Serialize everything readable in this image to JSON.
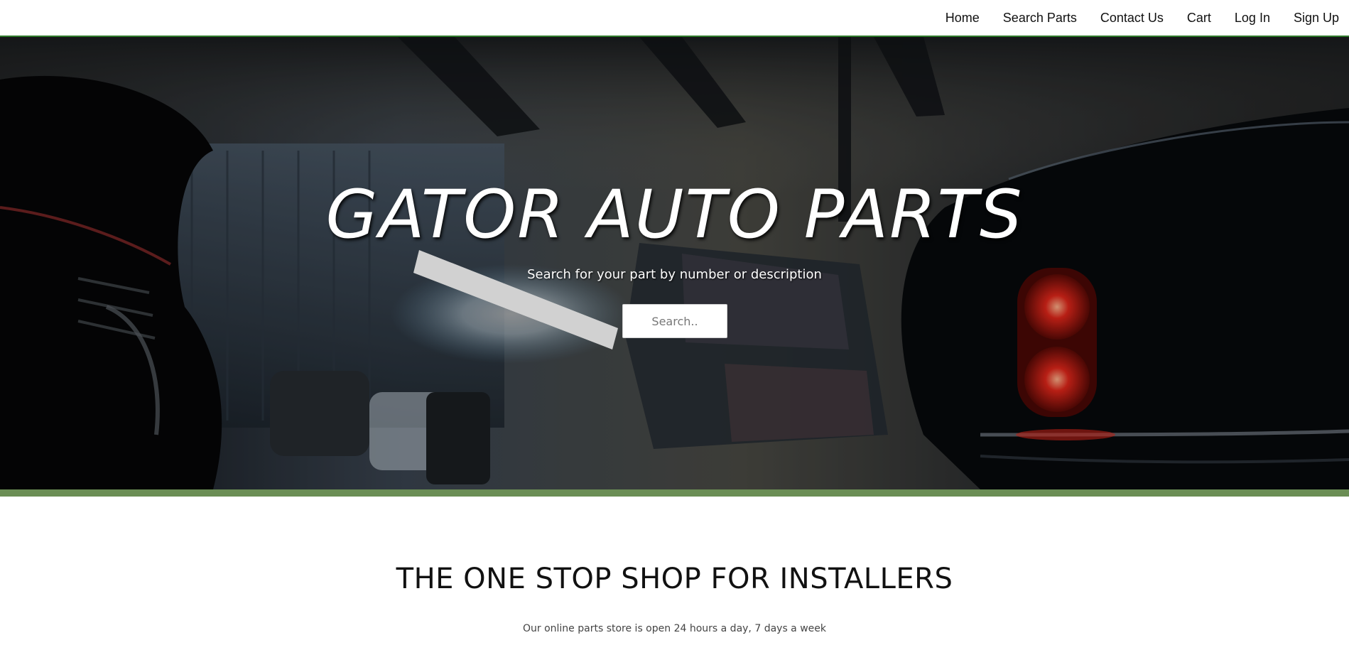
{
  "nav": {
    "items": [
      {
        "label": "Home"
      },
      {
        "label": "Search Parts"
      },
      {
        "label": "Contact Us"
      },
      {
        "label": "Cart"
      },
      {
        "label": "Log In"
      },
      {
        "label": "Sign Up"
      }
    ]
  },
  "hero": {
    "title": "GATOR AUTO PARTS",
    "subtitle": "Search for your part by number or description",
    "search_placeholder": "Search.."
  },
  "section": {
    "heading": "THE ONE STOP SHOP FOR INSTALLERS",
    "text": "Our online parts store is open 24 hours a day, 7 days a week"
  },
  "colors": {
    "nav_border": "#2f7a2b",
    "accent_bar": "#6b8e55",
    "taillight": "#e0261a"
  }
}
